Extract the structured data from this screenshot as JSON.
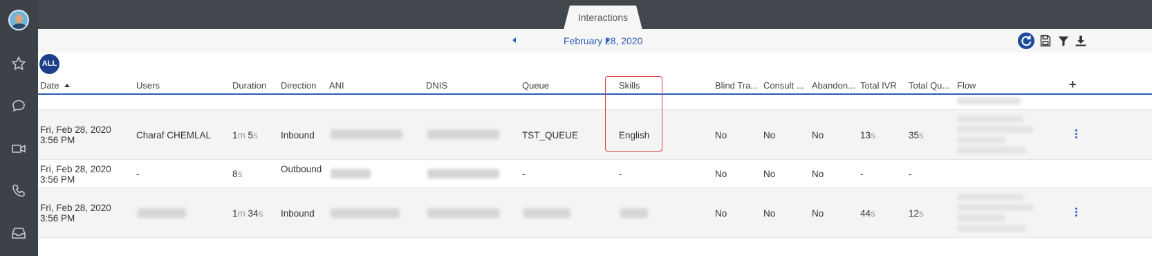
{
  "tab": {
    "label": "Interactions"
  },
  "datebar": {
    "date": "February 28, 2020"
  },
  "filter": {
    "all_label": "ALL"
  },
  "columns": {
    "date": "Date",
    "users": "Users",
    "duration": "Duration",
    "direction": "Direction",
    "ani": "ANI",
    "dnis": "DNIS",
    "queue": "Queue",
    "skills": "Skills",
    "blind": "Blind Tra...",
    "consult": "Consult ...",
    "abandon": "Abandon...",
    "total_ivr": "Total IVR",
    "total_queue": "Total Qu...",
    "flow": "Flow"
  },
  "rows": [
    {
      "date": "Fri, Feb 28, 2020 3:56 PM",
      "user": "Charaf CHEMLAL",
      "duration_a": "1",
      "duration_a_unit": "m",
      "duration_b": "5",
      "duration_b_unit": "s",
      "direction": "Inbound",
      "queue": "TST_QUEUE",
      "skills": "English",
      "blind": "No",
      "consult": "No",
      "abandon": "No",
      "ivr": "13",
      "ivr_unit": "s",
      "queue_time": "35",
      "queue_unit": "s"
    },
    {
      "date": "Fri, Feb 28, 2020 3:56 PM",
      "user": "-",
      "duration_b": "8",
      "duration_b_unit": "s",
      "direction": "Outbound",
      "queue": "-",
      "skills": "-",
      "blind": "No",
      "consult": "No",
      "abandon": "No",
      "ivr": "-",
      "queue_time": "-"
    },
    {
      "date": "Fri, Feb 28, 2020 3:56 PM",
      "duration_a": "1",
      "duration_a_unit": "m",
      "duration_b": "34",
      "duration_b_unit": "s",
      "direction": "Inbound",
      "blind": "No",
      "consult": "No",
      "abandon": "No",
      "ivr": "44",
      "ivr_unit": "s",
      "queue_time": "12",
      "queue_unit": "s"
    }
  ],
  "colors": {
    "accent": "#2e5cb8",
    "sidebar": "#3d4249",
    "highlight": "#d9393b"
  }
}
